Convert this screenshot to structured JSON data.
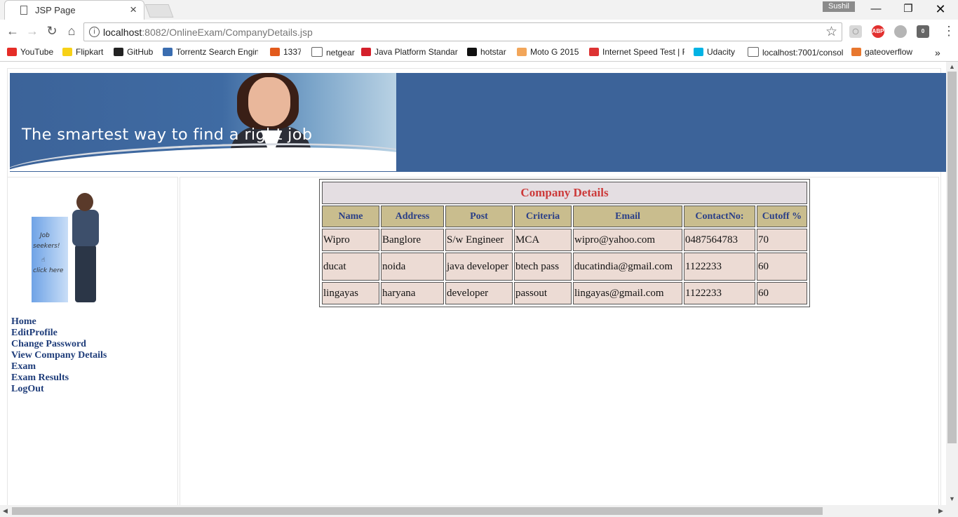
{
  "browser": {
    "tab_title": "JSP Page",
    "tab_close": "×",
    "profile": "Sushil",
    "url_host": "localhost",
    "url_rest": ":8082/OnlineExam/CompanyDetails.jsp",
    "bookmarks": [
      {
        "label": "YouTube",
        "icon": "youtube-icon",
        "color": "#e52d27"
      },
      {
        "label": "Flipkart",
        "icon": "flipkart-icon",
        "color": "#f7d117"
      },
      {
        "label": "GitHub",
        "icon": "github-icon",
        "color": "#222222"
      },
      {
        "label": "Torrentz Search Engin",
        "icon": "torrentz-icon",
        "color": "#3a6db0"
      },
      {
        "label": "1337",
        "icon": "x-icon",
        "color": "#e25a1c"
      },
      {
        "label": "netgear",
        "icon": "page-icon",
        "color": "#ffffff"
      },
      {
        "label": "Java Platform Standar",
        "icon": "oracle-icon",
        "color": "#d4202b"
      },
      {
        "label": "hotstar",
        "icon": "hotstar-icon",
        "color": "#111111"
      },
      {
        "label": "Moto G 2015",
        "icon": "xda-icon",
        "color": "#f2a65a"
      },
      {
        "label": "Internet Speed Test | F",
        "icon": "speedtest-icon",
        "color": "#d33"
      },
      {
        "label": "Udacity",
        "icon": "udacity-icon",
        "color": "#02b3e4"
      },
      {
        "label": "localhost:7001/consol",
        "icon": "page-icon",
        "color": "#ffffff"
      },
      {
        "label": "gateoverflow",
        "icon": "gateoverflow-icon",
        "color": "#e8772e"
      }
    ],
    "more_bookmarks": "»"
  },
  "banner": {
    "tagline": "The smartest way to find a right job"
  },
  "sidebar": {
    "figure_text_1": "Job",
    "figure_text_2": "seekers!",
    "figure_text_3": "click here",
    "links": [
      "Home",
      "EditProfile",
      "Change Password",
      "View Company Details",
      "Exam",
      "Exam Results",
      "LogOut"
    ]
  },
  "table": {
    "caption": "Company Details",
    "headers": [
      "Name",
      "Address",
      "Post",
      "Criteria",
      "Email",
      "ContactNo:",
      "Cutoff %"
    ],
    "rows": [
      [
        "Wipro",
        "Banglore",
        "S/w Engineer",
        "MCA",
        "wipro@yahoo.com",
        "0487564783",
        "70"
      ],
      [
        "ducat",
        "noida",
        "java developer",
        "btech pass",
        "ducatindia@gmail.com",
        "1122233",
        "60"
      ],
      [
        "lingayas",
        "haryana",
        "developer",
        "passout",
        "lingayas@gmail.com",
        "1122233",
        "60"
      ]
    ]
  },
  "colors": {
    "banner_bg": "#3c6399",
    "caption_text": "#cc3a3a",
    "header_bg": "#c9bd8e",
    "header_text": "#2a3f88",
    "cell_bg": "#ecdbd4",
    "link_text": "#1f3d7a"
  }
}
